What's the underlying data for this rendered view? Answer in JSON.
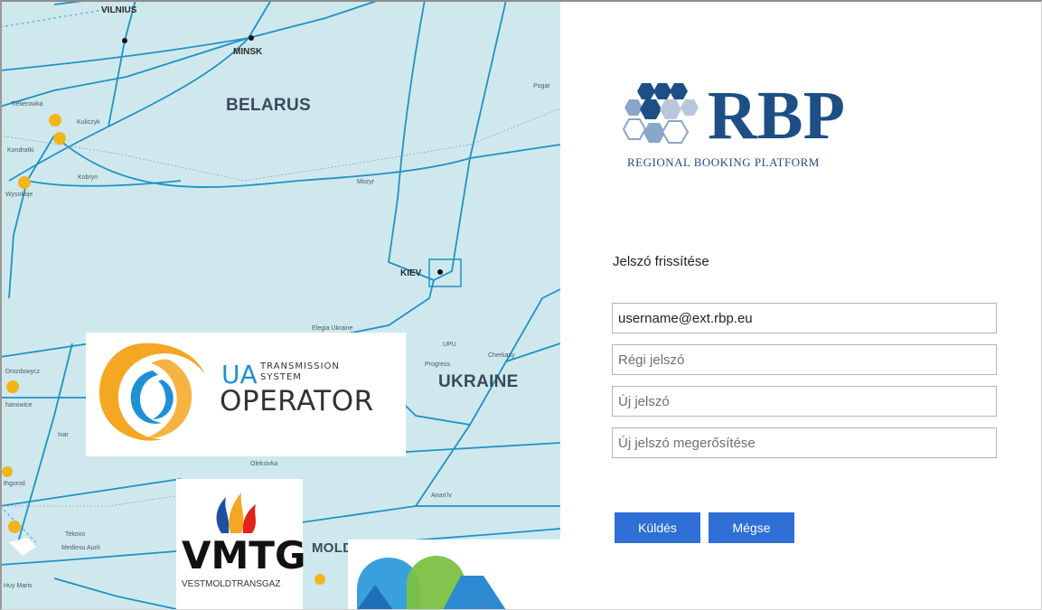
{
  "map": {
    "countries": [
      "BELARUS",
      "UKRAINE",
      "MOLD"
    ],
    "cities": [
      "VILNIUS",
      "MINSK",
      "KIEV"
    ],
    "small_labels": [
      "Tietierowka",
      "Kondratki",
      "Wysokoje",
      "Kobryn",
      "Mozyr",
      "Pogar",
      "Drozdowycz",
      "hanowice",
      "Ivar",
      "Oleksivka",
      "thgorod",
      "Tekovo",
      "Mediesu Aurit",
      "Anan'iv",
      "Cherkasy",
      "UPU",
      "Progress",
      "Elegia Ukraine",
      "Kuliczyk",
      "Huy Maris"
    ]
  },
  "logos": {
    "uats": {
      "ua": "UA",
      "transmission": "TRANSMISSION",
      "system": "SYSTEM",
      "operator": "OPERATOR"
    },
    "vmtg": {
      "name": "VMTG",
      "sub": "VESTMOLDTRANSGAZ"
    },
    "rbp": {
      "name": "RBP",
      "sub": "REGIONAL BOOKING PLATFORM"
    }
  },
  "form": {
    "title": "Jelszó frissítése",
    "username_value": "username@ext.rbp.eu",
    "old_password_placeholder": "Régi jelszó",
    "new_password_placeholder": "Új jelszó",
    "confirm_password_placeholder": "Új jelszó megerősítése",
    "submit_label": "Küldés",
    "cancel_label": "Mégse"
  },
  "colors": {
    "button": "#2f6fd6",
    "map_bg": "#cfe8ee",
    "pipeline": "#1f93c4",
    "brand": "#1d4f86",
    "node": "#f1b51c"
  }
}
